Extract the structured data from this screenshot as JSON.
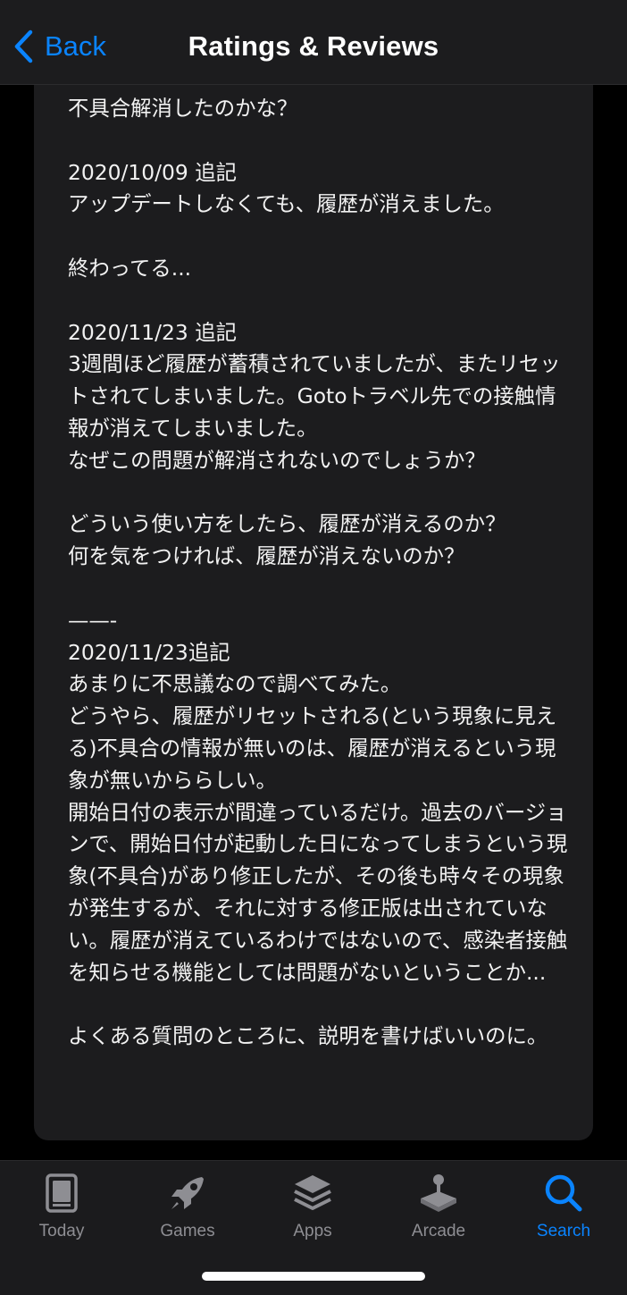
{
  "navbar": {
    "back_label": "Back",
    "title": "Ratings & Reviews"
  },
  "review": {
    "body": "不具合解消したのかな？\n\n2020/10/09 追記\nアップデートしなくても、履歴が消えました。\n\n終わってる...\n\n2020/11/23 追記\n3週間ほど履歴が蓄積されていましたが、またリセットされてしまいました。Gotoトラベル先での接触情報が消えてしまいました。\nなぜこの問題が解消されないのでしょうか？\n\nどういう使い方をしたら、履歴が消えるのか？\n何を気をつければ、履歴が消えないのか？\n\n——-\n2020/11/23追記\nあまりに不思議なので調べてみた。\nどうやら、履歴がリセットされる(という現象に見える)不具合の情報が無いのは、履歴が消えるという現象が無いかららしい。\n開始日付の表示が間違っているだけ。過去のバージョンで、開始日付が起動した日になってしまうという現象(不具合)があり修正したが、その後も時々その現象が発生するが、それに対する修正版は出されていない。履歴が消えているわけではないので、感染者接触を知らせる機能としては問題がないということか...\n\nよくある質問のところに、説明を書けばいいのに。"
  },
  "tabs": [
    {
      "label": "Today",
      "icon": "today-icon",
      "active": false
    },
    {
      "label": "Games",
      "icon": "rocket-icon",
      "active": false
    },
    {
      "label": "Apps",
      "icon": "layers-icon",
      "active": false
    },
    {
      "label": "Arcade",
      "icon": "joystick-icon",
      "active": false
    },
    {
      "label": "Search",
      "icon": "search-icon",
      "active": true
    }
  ],
  "colors": {
    "accent": "#0a84ff",
    "inactive": "#8e8e93",
    "card": "#1c1c1e",
    "background": "#000000"
  }
}
